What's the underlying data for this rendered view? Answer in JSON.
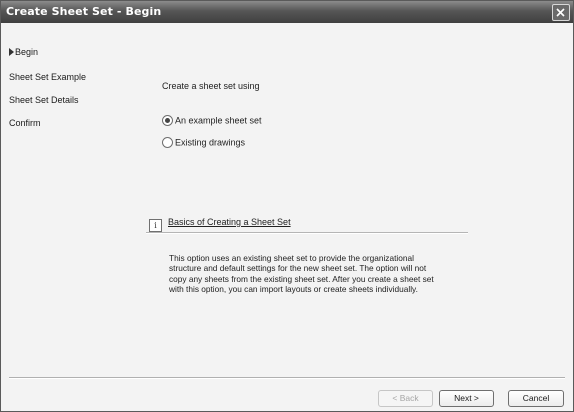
{
  "window": {
    "title": "Create Sheet Set - Begin"
  },
  "nav": {
    "items": [
      {
        "label": "Begin",
        "current": true
      },
      {
        "label": "Sheet Set Example",
        "current": false
      },
      {
        "label": "Sheet Set Details",
        "current": false
      },
      {
        "label": "Confirm",
        "current": false
      }
    ]
  },
  "main": {
    "prompt": "Create a sheet set using",
    "options": [
      {
        "label": "An example sheet set",
        "selected": true
      },
      {
        "label": "Existing drawings",
        "selected": false
      }
    ],
    "info_link": "Basics of Creating a Sheet Set",
    "info_icon": "i",
    "description": "This option uses an existing sheet set to provide the organizational structure and default settings for the new sheet set.  The option will not copy any sheets from the existing sheet set.  After you create a sheet set with this option, you can import layouts or create sheets individually."
  },
  "buttons": {
    "back": "< Back",
    "next": "Next >",
    "cancel": "Cancel"
  }
}
